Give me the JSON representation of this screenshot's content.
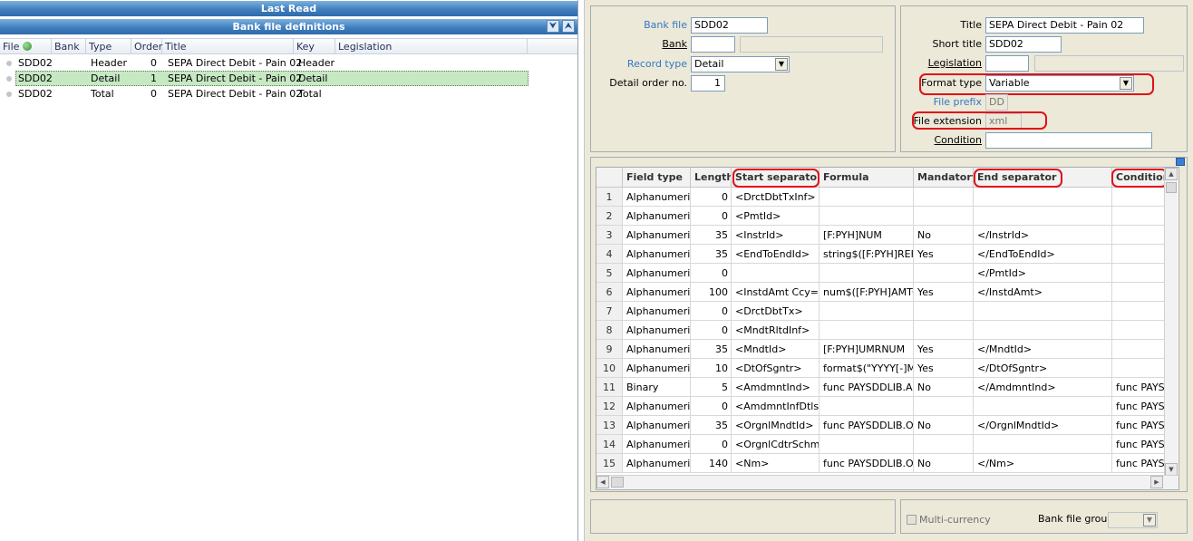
{
  "left_panel": {
    "last_read_title": "Last Read",
    "bank_defs_title": "Bank file definitions",
    "columns": [
      "File",
      "Bank",
      "Type",
      "Order",
      "Title",
      "Key",
      "Legislation"
    ],
    "rows": [
      {
        "file": "SDD02",
        "type": "Header",
        "order": "0",
        "title": "SEPA Direct Debit - Pain 02",
        "key": "Header"
      },
      {
        "file": "SDD02",
        "type": "Detail",
        "order": "1",
        "title": "SEPA Direct Debit - Pain 02",
        "key": "Detail"
      },
      {
        "file": "SDD02",
        "type": "Total",
        "order": "0",
        "title": "SEPA Direct Debit - Pain 02",
        "key": "Total"
      }
    ]
  },
  "form_left": {
    "bank_file_label": "Bank file",
    "bank_file_value": "SDD02",
    "bank_label": "Bank",
    "record_type_label": "Record type",
    "record_type_value": "Detail",
    "detail_order_label": "Detail order no.",
    "detail_order_value": "1"
  },
  "form_right": {
    "title_label": "Title",
    "title_value": "SEPA Direct Debit - Pain 02",
    "short_title_label": "Short title",
    "short_title_value": "SDD02",
    "legislation_label": "Legislation",
    "format_type_label": "Format type",
    "format_type_value": "Variable",
    "file_prefix_label": "File prefix",
    "file_prefix_value": "DD",
    "file_extension_label": "File extension",
    "file_extension_value": "xml",
    "condition_label": "Condition"
  },
  "grid": {
    "columns": [
      "Field type",
      "Length",
      "Start separator",
      "Formula",
      "Mandatory",
      "End separator",
      "Condition"
    ],
    "rows": [
      {
        "n": "1",
        "field_type": "Alphanumeric",
        "length": "0",
        "start": "<DrctDbtTxInf>",
        "formula": "",
        "mandatory": "",
        "end": "",
        "condition": ""
      },
      {
        "n": "2",
        "field_type": "Alphanumeric",
        "length": "0",
        "start": "<PmtId>",
        "formula": "",
        "mandatory": "",
        "end": "",
        "condition": ""
      },
      {
        "n": "3",
        "field_type": "Alphanumeric",
        "length": "35",
        "start": "<InstrId>",
        "formula": "[F:PYH]NUM",
        "mandatory": "No",
        "end": "</InstrId>",
        "condition": ""
      },
      {
        "n": "4",
        "field_type": "Alphanumeric",
        "length": "35",
        "start": "<EndToEndId>",
        "formula": "string$([F:PYH]REF<",
        "mandatory": "Yes",
        "end": "</EndToEndId>",
        "condition": ""
      },
      {
        "n": "5",
        "field_type": "Alphanumeric",
        "length": "0",
        "start": "",
        "formula": "",
        "mandatory": "",
        "end": "</PmtId>",
        "condition": ""
      },
      {
        "n": "6",
        "field_type": "Alphanumeric",
        "length": "100",
        "start": "<InstdAmt Ccy=\"EU",
        "formula": "num$([F:PYH]AMTCU",
        "mandatory": "Yes",
        "end": "</InstdAmt>",
        "condition": ""
      },
      {
        "n": "7",
        "field_type": "Alphanumeric",
        "length": "0",
        "start": "<DrctDbtTx>",
        "formula": "",
        "mandatory": "",
        "end": "",
        "condition": ""
      },
      {
        "n": "8",
        "field_type": "Alphanumeric",
        "length": "0",
        "start": "<MndtRltdInf>",
        "formula": "",
        "mandatory": "",
        "end": "",
        "condition": ""
      },
      {
        "n": "9",
        "field_type": "Alphanumeric",
        "length": "35",
        "start": "<MndtId>",
        "formula": "[F:PYH]UMRNUM",
        "mandatory": "Yes",
        "end": "</MndtId>",
        "condition": ""
      },
      {
        "n": "10",
        "field_type": "Alphanumeric",
        "length": "10",
        "start": "<DtOfSgntr>",
        "formula": "format$(\"YYYY[-]MM",
        "mandatory": "Yes",
        "end": "</DtOfSgntr>",
        "condition": ""
      },
      {
        "n": "11",
        "field_type": "Binary",
        "length": "5",
        "start": "<AmdmntInd>",
        "formula": "func PAYSDDLIB.AM",
        "mandatory": "No",
        "end": "</AmdmntInd>",
        "condition": "func PAYSD"
      },
      {
        "n": "12",
        "field_type": "Alphanumeric",
        "length": "0",
        "start": "<AmdmntInfDtls>",
        "formula": "",
        "mandatory": "",
        "end": "",
        "condition": "func PAYSD"
      },
      {
        "n": "13",
        "field_type": "Alphanumeric",
        "length": "35",
        "start": "<OrgnlMndtId>",
        "formula": "func PAYSDDLIB.OL",
        "mandatory": "No",
        "end": "</OrgnlMndtId>",
        "condition": "func PAYSD"
      },
      {
        "n": "14",
        "field_type": "Alphanumeric",
        "length": "0",
        "start": "<OrgnlCdtrSchmeId",
        "formula": "",
        "mandatory": "",
        "end": "",
        "condition": "func PAYSD"
      },
      {
        "n": "15",
        "field_type": "Alphanumeric",
        "length": "140",
        "start": "<Nm>",
        "formula": "func PAYSDDLIB.OL",
        "mandatory": "No",
        "end": "</Nm>",
        "condition": "func PAYSD"
      }
    ]
  },
  "bottom": {
    "multi_currency_label": "Multi-currency",
    "bank_file_group_label": "Bank file group"
  },
  "colors": {
    "highlight_red": "#e0101a",
    "selected_row": "#c6e8c3",
    "title_bar": "#3f7fbf"
  }
}
